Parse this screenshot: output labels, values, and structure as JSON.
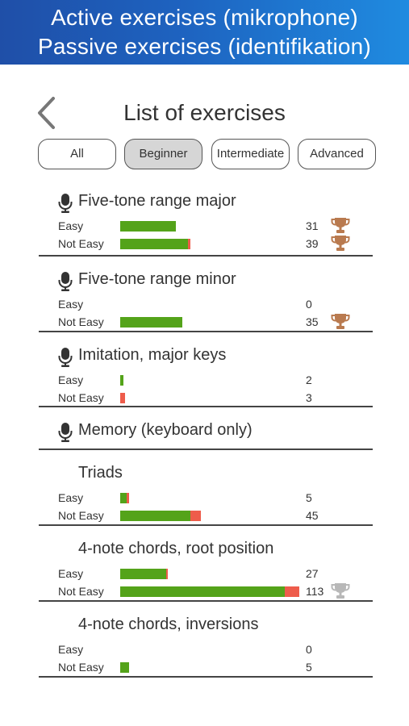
{
  "banner": {
    "line1": "Active exercises (mikrophone)",
    "line2": "Passive exercises (identifikation)"
  },
  "header": {
    "title": "List of exercises"
  },
  "filters": [
    {
      "label": "All",
      "active": false
    },
    {
      "label": "Beginner",
      "active": true
    },
    {
      "label": "Intermediate",
      "active": false
    },
    {
      "label": "Advanced",
      "active": false
    }
  ],
  "exercises": [
    {
      "title": "Five-tone range major",
      "mic": true,
      "rows": [
        {
          "label": "Easy",
          "count": "31",
          "green": 0.27,
          "red": 0.0,
          "trophy": "bronze"
        },
        {
          "label": "Not Easy",
          "count": "39",
          "green": 0.33,
          "red": 0.01,
          "trophy": "bronze"
        }
      ]
    },
    {
      "title": "Five-tone range minor",
      "mic": true,
      "rows": [
        {
          "label": "Easy",
          "count": "0",
          "green": 0.0,
          "red": 0.0,
          "trophy": ""
        },
        {
          "label": "Not Easy",
          "count": "35",
          "green": 0.3,
          "red": 0.0,
          "trophy": "bronze"
        }
      ]
    },
    {
      "title": "Imitation, major keys",
      "mic": true,
      "rows": [
        {
          "label": "Easy",
          "count": "2",
          "green": 0.015,
          "red": 0.0,
          "trophy": ""
        },
        {
          "label": "Not Easy",
          "count": "3",
          "green": 0.0,
          "red": 0.025,
          "trophy": ""
        }
      ]
    },
    {
      "title": "Memory (keyboard only)",
      "mic": true,
      "rows": []
    },
    {
      "title": "Triads",
      "mic": false,
      "rows": [
        {
          "label": "Easy",
          "count": "5",
          "green": 0.03,
          "red": 0.012,
          "trophy": ""
        },
        {
          "label": "Not Easy",
          "count": "45",
          "green": 0.34,
          "red": 0.05,
          "trophy": ""
        }
      ]
    },
    {
      "title": "4-note chords, root position",
      "mic": false,
      "rows": [
        {
          "label": "Easy",
          "count": "27",
          "green": 0.225,
          "red": 0.008,
          "trophy": ""
        },
        {
          "label": "Not Easy",
          "count": "113",
          "green": 0.8,
          "red": 0.07,
          "trophy": "silver"
        }
      ]
    },
    {
      "title": "4-note chords, inversions",
      "mic": false,
      "rows": [
        {
          "label": "Easy",
          "count": "0",
          "green": 0.0,
          "red": 0.0,
          "trophy": ""
        },
        {
          "label": "Not Easy",
          "count": "5",
          "green": 0.045,
          "red": 0.0,
          "trophy": ""
        }
      ]
    }
  ],
  "colors": {
    "green": "#54a31a",
    "red": "#ee5c4b",
    "bronze": "#b97a4f",
    "silver": "#b8b8b8"
  },
  "icons": {
    "back": "chevron-left-icon",
    "mic": "microphone-icon",
    "trophy": "trophy-icon"
  }
}
